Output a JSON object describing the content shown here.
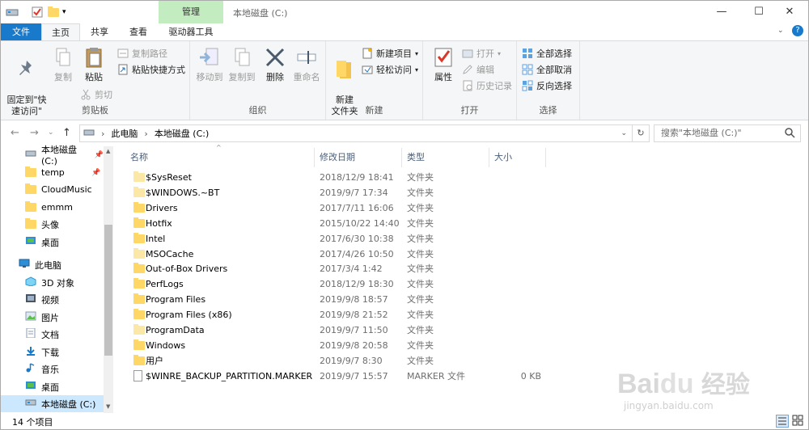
{
  "window": {
    "title": "本地磁盘 (C:)",
    "context_tab": "管理",
    "minimize": "—",
    "maximize": "☐",
    "close": "✕"
  },
  "tabs": [
    "文件",
    "主页",
    "共享",
    "查看",
    "驱动器工具"
  ],
  "ribbon": {
    "clipboard": {
      "label": "剪贴板",
      "pin": "固定到\"快\n速访问\"",
      "copy": "复制",
      "paste": "粘贴",
      "copy_path": "复制路径",
      "paste_shortcut": "粘贴快捷方式",
      "cut": "剪切"
    },
    "organize": {
      "label": "组织",
      "move_to": "移动到",
      "copy_to": "复制到",
      "delete": "删除",
      "rename": "重命名"
    },
    "new": {
      "label": "新建",
      "new_folder": "新建\n文件夹",
      "new_item": "新建项目",
      "easy_access": "轻松访问"
    },
    "open": {
      "label": "打开",
      "properties": "属性",
      "open": "打开",
      "edit": "编辑",
      "history": "历史记录"
    },
    "select": {
      "label": "选择",
      "select_all": "全部选择",
      "select_none": "全部取消",
      "invert": "反向选择"
    }
  },
  "address": {
    "crumbs": [
      "此电脑",
      "本地磁盘 (C:)"
    ],
    "search_placeholder": "搜索\"本地磁盘 (C:)\""
  },
  "nav": {
    "items": [
      {
        "label": "本地磁盘 (C:)",
        "pinned": true
      },
      {
        "label": "temp",
        "pinned": true
      },
      {
        "label": "CloudMusic"
      },
      {
        "label": "emmm"
      },
      {
        "label": "头像"
      },
      {
        "label": "桌面"
      },
      {
        "label": "此电脑"
      },
      {
        "label": "3D 对象"
      },
      {
        "label": "视频"
      },
      {
        "label": "图片"
      },
      {
        "label": "文档"
      },
      {
        "label": "下载"
      },
      {
        "label": "音乐"
      },
      {
        "label": "桌面"
      },
      {
        "label": "本地磁盘 (C:)",
        "selected": true
      }
    ]
  },
  "columns": [
    "名称",
    "修改日期",
    "类型",
    "大小"
  ],
  "files": [
    {
      "name": "$SysReset",
      "date": "2018/12/9 18:41",
      "type": "文件夹",
      "size": "",
      "light": true
    },
    {
      "name": "$WINDOWS.~BT",
      "date": "2019/9/7 17:34",
      "type": "文件夹",
      "size": "",
      "light": true
    },
    {
      "name": "Drivers",
      "date": "2017/7/11 16:06",
      "type": "文件夹",
      "size": ""
    },
    {
      "name": "Hotfix",
      "date": "2015/10/22 14:40",
      "type": "文件夹",
      "size": ""
    },
    {
      "name": "Intel",
      "date": "2017/6/30 10:38",
      "type": "文件夹",
      "size": ""
    },
    {
      "name": "MSOCache",
      "date": "2017/4/26 10:50",
      "type": "文件夹",
      "size": "",
      "light": true
    },
    {
      "name": "Out-of-Box Drivers",
      "date": "2017/3/4 1:42",
      "type": "文件夹",
      "size": ""
    },
    {
      "name": "PerfLogs",
      "date": "2018/12/9 18:30",
      "type": "文件夹",
      "size": ""
    },
    {
      "name": "Program Files",
      "date": "2019/9/8 18:57",
      "type": "文件夹",
      "size": ""
    },
    {
      "name": "Program Files (x86)",
      "date": "2019/9/8 21:52",
      "type": "文件夹",
      "size": ""
    },
    {
      "name": "ProgramData",
      "date": "2019/9/7 11:50",
      "type": "文件夹",
      "size": "",
      "light": true
    },
    {
      "name": "Windows",
      "date": "2019/9/8 20:58",
      "type": "文件夹",
      "size": ""
    },
    {
      "name": "用户",
      "date": "2019/9/7 8:30",
      "type": "文件夹",
      "size": ""
    },
    {
      "name": "$WINRE_BACKUP_PARTITION.MARKER",
      "date": "2019/9/7 15:57",
      "type": "MARKER 文件",
      "size": "0 KB",
      "file": true
    }
  ],
  "status": {
    "count": "14 个项目"
  },
  "watermark": {
    "brand": "Bai",
    "brand2": "经验",
    "url": "jingyan.baidu.com"
  }
}
